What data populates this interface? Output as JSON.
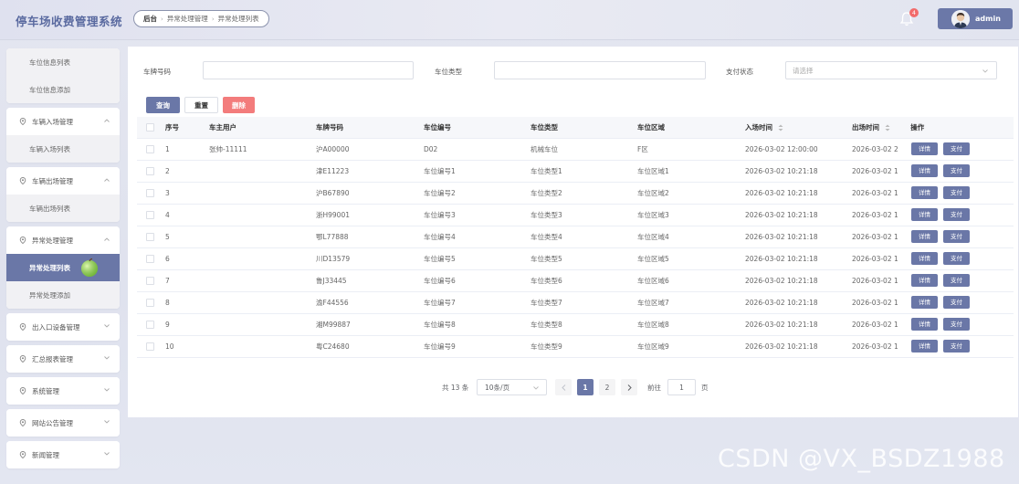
{
  "header": {
    "app_title": "停车场收费管理系统",
    "breadcrumb": [
      "后台",
      "异常处理管理",
      "异常处理列表"
    ],
    "notification_count": "4",
    "username": "admin"
  },
  "sidebar": {
    "top_items": [
      "车位信息列表",
      "车位信息添加"
    ],
    "groups": [
      {
        "label": "车辆入场管理",
        "items": [
          "车辆入场列表"
        ],
        "expanded": true
      },
      {
        "label": "车辆出场管理",
        "items": [
          "车辆出场列表"
        ],
        "expanded": true
      },
      {
        "label": "异常处理管理",
        "items": [
          "异常处理列表",
          "异常处理添加"
        ],
        "expanded": true,
        "active_item": "异常处理列表"
      },
      {
        "label": "出入口设备管理",
        "items": [],
        "expanded": false
      },
      {
        "label": "汇总报表管理",
        "items": [],
        "expanded": false
      },
      {
        "label": "系统管理",
        "items": [],
        "expanded": false
      },
      {
        "label": "网站公告管理",
        "items": [],
        "expanded": false
      },
      {
        "label": "新闻管理",
        "items": [],
        "expanded": false
      }
    ]
  },
  "filters": {
    "plate_label": "车牌号码",
    "plate_value": "",
    "space_type_label": "车位类型",
    "space_type_value": "",
    "pay_status_label": "支付状态",
    "pay_status_placeholder": "请选择"
  },
  "actions": {
    "search": "查询",
    "reset": "重置",
    "delete": "删除"
  },
  "table": {
    "columns": [
      "序号",
      "车主用户",
      "车牌号码",
      "车位编号",
      "车位类型",
      "车位区域",
      "入场时间",
      "出场时间",
      "操作"
    ],
    "rows": [
      [
        "1",
        "张帅-11111",
        "沪A00000",
        "D02",
        "机械车位",
        "F区",
        "2026-03-02 12:00:00",
        "2026-03-02 2"
      ],
      [
        "2",
        "",
        "津E11223",
        "车位编号1",
        "车位类型1",
        "车位区域1",
        "2026-03-02 10:21:18",
        "2026-03-02 1"
      ],
      [
        "3",
        "",
        "沪B67890",
        "车位编号2",
        "车位类型2",
        "车位区域2",
        "2026-03-02 10:21:18",
        "2026-03-02 1"
      ],
      [
        "4",
        "",
        "浙H99001",
        "车位编号3",
        "车位类型3",
        "车位区域3",
        "2026-03-02 10:21:18",
        "2026-03-02 1"
      ],
      [
        "5",
        "",
        "鄂L77888",
        "车位编号4",
        "车位类型4",
        "车位区域4",
        "2026-03-02 10:21:18",
        "2026-03-02 1"
      ],
      [
        "6",
        "",
        "川D13579",
        "车位编号5",
        "车位类型5",
        "车位区域5",
        "2026-03-02 10:21:18",
        "2026-03-02 1"
      ],
      [
        "7",
        "",
        "鲁J33445",
        "车位编号6",
        "车位类型6",
        "车位区域6",
        "2026-03-02 10:21:18",
        "2026-03-02 1"
      ],
      [
        "8",
        "",
        "渝F44556",
        "车位编号7",
        "车位类型7",
        "车位区域7",
        "2026-03-02 10:21:18",
        "2026-03-02 1"
      ],
      [
        "9",
        "",
        "湘M99887",
        "车位编号8",
        "车位类型8",
        "车位区域8",
        "2026-03-02 10:21:18",
        "2026-03-02 1"
      ],
      [
        "10",
        "",
        "粤C24680",
        "车位编号9",
        "车位类型9",
        "车位区域9",
        "2026-03-02 10:21:18",
        "2026-03-02 1"
      ]
    ],
    "row_actions": [
      "详情",
      "支付"
    ]
  },
  "pagination": {
    "total": "共 13 条",
    "page_size": "10条/页",
    "pages": [
      "1",
      "2"
    ],
    "current_page": "1",
    "goto_label": "前往",
    "goto_value": "1",
    "goto_unit": "页"
  },
  "watermark": "CSDN @VX_BSDZ1988",
  "colors": {
    "accent": "#6a77a7",
    "danger": "#f37c7c",
    "badge": "#f26b6b"
  }
}
